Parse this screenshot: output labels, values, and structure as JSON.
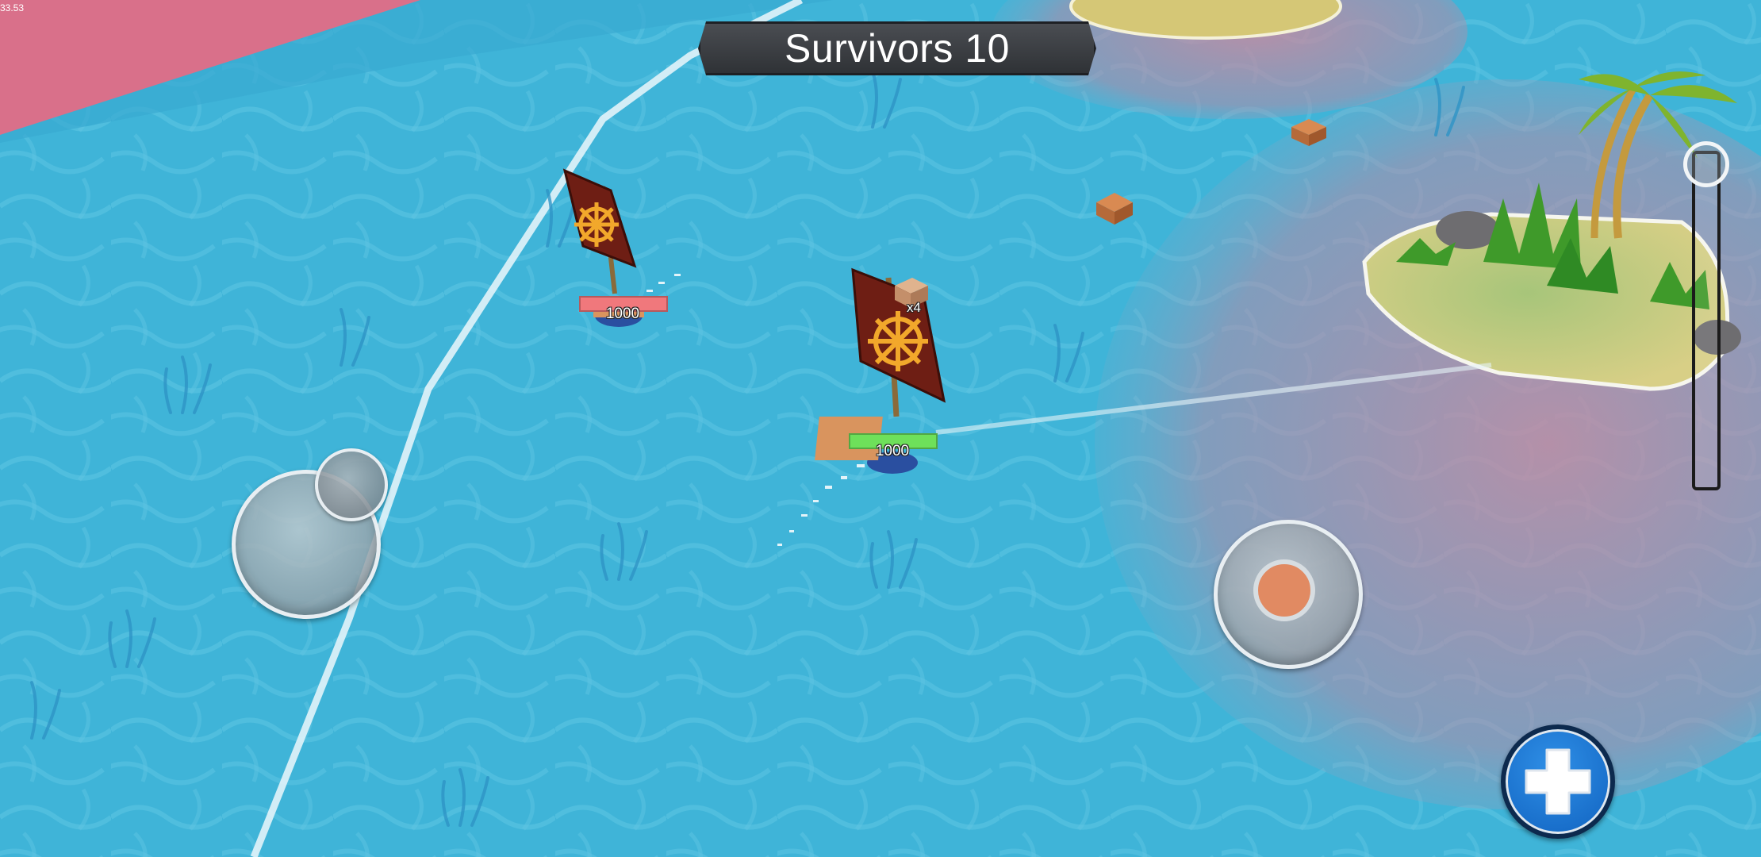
{
  "hud": {
    "survivors_label": "Survivors 10",
    "fps": "33.53"
  },
  "ships": {
    "enemy": {
      "hp": "1000",
      "hp_fraction": 1.0,
      "bar_color": "#f0787c"
    },
    "player": {
      "hp": "1000",
      "hp_fraction": 1.0,
      "bar_color": "#6ee05a",
      "multiplier": "x4"
    }
  },
  "controls": {
    "move_joystick_icon": "joystick-icon",
    "fire_joystick_icon": "joystick-icon",
    "heal_icon": "plus-icon",
    "zoom_level": 0.0
  },
  "colors": {
    "water": "#3fb4d8",
    "danger_zone": "#d9708a",
    "sail": "#6e1e14",
    "emblem": "#f2a82b",
    "island_sand": "#dcd48a",
    "heal_button": "#1a74d4"
  }
}
